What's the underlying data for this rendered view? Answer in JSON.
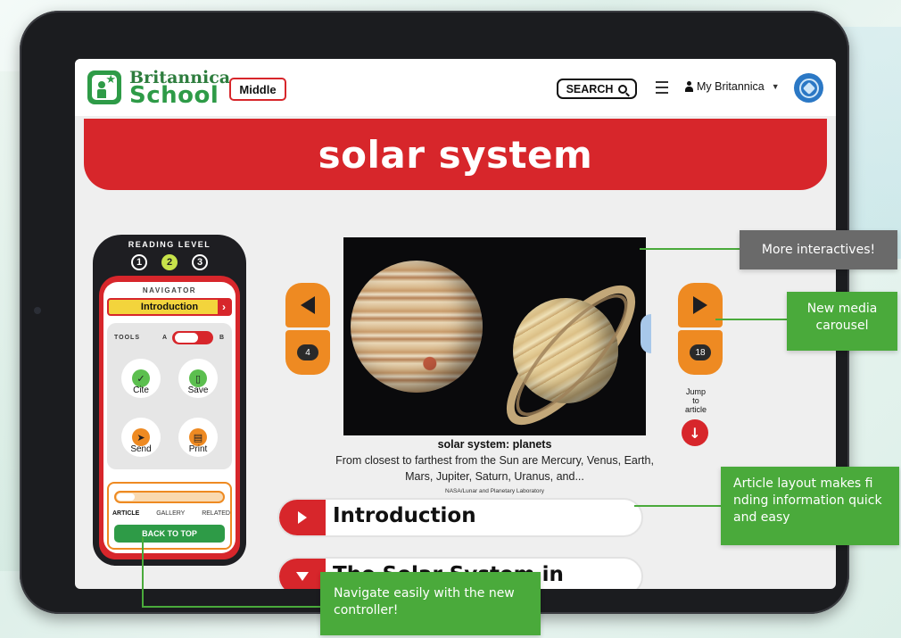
{
  "brand": {
    "line1": "Britannica",
    "line2": "School"
  },
  "header": {
    "level_button": "Middle",
    "search_label": "SEARCH",
    "account_label": "My Britannica"
  },
  "page_title": "solar system",
  "navigator": {
    "reading_level_label": "READING LEVEL",
    "reading_levels": [
      "1",
      "2",
      "3"
    ],
    "active_level": "2",
    "navigator_label": "NAVIGATOR",
    "current_section": "Introduction",
    "tools_label": "TOOLS",
    "toggle_a": "A",
    "toggle_b": "B",
    "tools": [
      {
        "label": "Cite",
        "icon": "cite-icon"
      },
      {
        "label": "Save",
        "icon": "bookmark-icon"
      },
      {
        "label": "Send",
        "icon": "send-icon"
      },
      {
        "label": "Print",
        "icon": "print-icon"
      }
    ],
    "view_tabs": [
      "ARTICLE",
      "GALLERY",
      "RELATED"
    ],
    "active_tab": "ARTICLE",
    "back_to_top": "BACK TO TOP"
  },
  "carousel": {
    "prev_count": "4",
    "next_count": "18",
    "jump_label_1": "Jump",
    "jump_label_2": "to",
    "jump_label_3": "article",
    "image_subject": "Jupiter and Saturn",
    "caption_title": "solar system: planets",
    "caption_text": "From closest to farthest from the Sun are Mercury, Venus, Earth, Mars, Jupiter, Saturn, Uranus, and...",
    "caption_credit": "NASA/Lunar and Planetary Laboratory"
  },
  "sections": [
    {
      "title": "Introduction"
    },
    {
      "title": "The Solar System in"
    }
  ],
  "callouts": {
    "more_interactives": "More interactives!",
    "media_carousel": "New media carousel",
    "article_layout": "Article layout makes fi nding information quick and easy",
    "controller": "Navigate easily with the new controller!"
  },
  "colors": {
    "brand_green": "#2e9b47",
    "banner_red": "#d7262b",
    "accent_orange": "#ee8a22",
    "level_highlight": "#c7e34a",
    "callout_green": "#4aaa3b",
    "callout_gray": "#6a6a6a"
  }
}
